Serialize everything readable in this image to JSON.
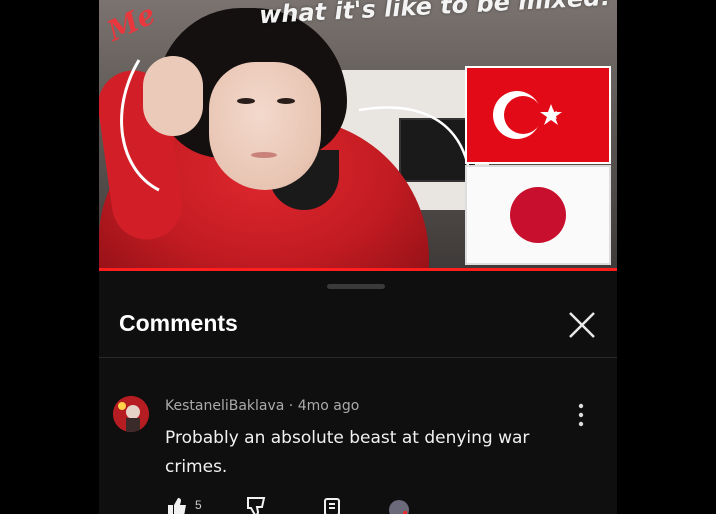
{
  "thumbnail": {
    "me_label": "Me",
    "title_overlay": "what it's like to be mixed!",
    "flags": [
      "turkey-flag-icon",
      "japan-flag-icon"
    ],
    "colors": {
      "turkey_red": "#e30a17",
      "japan_red": "#c8102e",
      "hoodie_red": "#d21f27"
    }
  },
  "panel": {
    "title": "Comments",
    "close_icon": "close-icon"
  },
  "comment": {
    "author": "KestaneliBaklava",
    "separator": " · ",
    "age": "4mo ago",
    "text": "Probably an absolute beast at denying war crimes.",
    "actions": [
      "like-icon",
      "dislike-icon",
      "reply-icon",
      "creator-heart-icon"
    ],
    "like_count": "5"
  },
  "theme": {
    "background": "#0f0f0f",
    "accent": "#ff1f1f",
    "text": "#f1f1f1",
    "muted": "#aaaaaa"
  }
}
